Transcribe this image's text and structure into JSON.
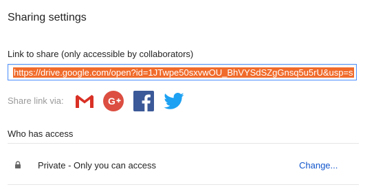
{
  "dialog": {
    "title": "Sharing settings"
  },
  "link": {
    "label": "Link to share (only accessible by collaborators)",
    "url": "https://drive.google.com/open?id=1JTwpe50sxvwOU_BhVYSdSZgGnsq5u5rU&usp=s"
  },
  "share": {
    "label": "Share link via:",
    "services": [
      "gmail-icon",
      "google-plus-icon",
      "facebook-icon",
      "twitter-icon"
    ],
    "colors": {
      "gmail": "#d93025",
      "google_plus": "#dc4e41",
      "facebook": "#3b5998",
      "twitter": "#1da1f2"
    }
  },
  "access": {
    "label": "Who has access",
    "icon": "lock-icon",
    "description": "Private - Only you can access",
    "change_label": "Change..."
  },
  "colors": {
    "selection": "#f06b2b",
    "link": "#1155cc",
    "focus_border": "#4d90fe"
  }
}
